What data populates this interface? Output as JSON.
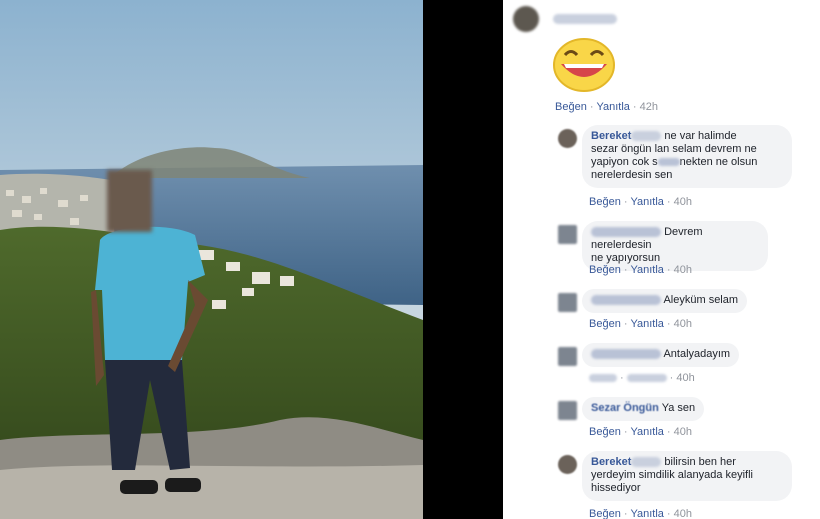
{
  "comments_panel": {
    "top_post": {
      "author_blurred": "Sezar Öngün",
      "sticker": "laughing-face-sticker",
      "actions": {
        "like": "Beğen",
        "reply": "Yanıtla",
        "time": "42h"
      }
    },
    "replies": [
      {
        "author_visible": "Bereket",
        "lines": [
          "ne var halimde",
          "sezar öngün lan selam devrem ne",
          "yapiyon cok s",
          "nekten ne olsun",
          "nerelerdesin sen"
        ],
        "actions": {
          "like": "Beğen",
          "reply": "Yanıtla",
          "time": "40h"
        }
      },
      {
        "lines": [
          "Devrem nerelerdesin",
          "ne yapıyorsun"
        ],
        "actions": {
          "like": "Beğen",
          "reply": "Yanıtla",
          "time": "40h"
        }
      },
      {
        "lines": [
          "Aleyküm selam"
        ],
        "actions": {
          "like": "Beğen",
          "reply": "Yanıtla",
          "time": "40h"
        }
      },
      {
        "lines": [
          "Antalyadayım"
        ],
        "actions": {
          "time": "40h"
        }
      },
      {
        "author_visible": "Sezar Öngün",
        "lines": [
          "Ya sen"
        ],
        "actions": {
          "like": "Beğen",
          "reply": "Yanıtla",
          "time": "40h"
        }
      },
      {
        "author_visible": "Bereket",
        "lines": [
          "bilirsin ben her",
          "yerdeyim simdilik alanyada keyifli",
          "hissediyor"
        ],
        "actions": {
          "like": "Beğen",
          "reply": "Yanıtla",
          "time": "40h"
        }
      }
    ]
  },
  "colors": {
    "link": "#385898",
    "muted": "#90949c",
    "bubble": "#f2f3f5",
    "divider": "#000000"
  }
}
